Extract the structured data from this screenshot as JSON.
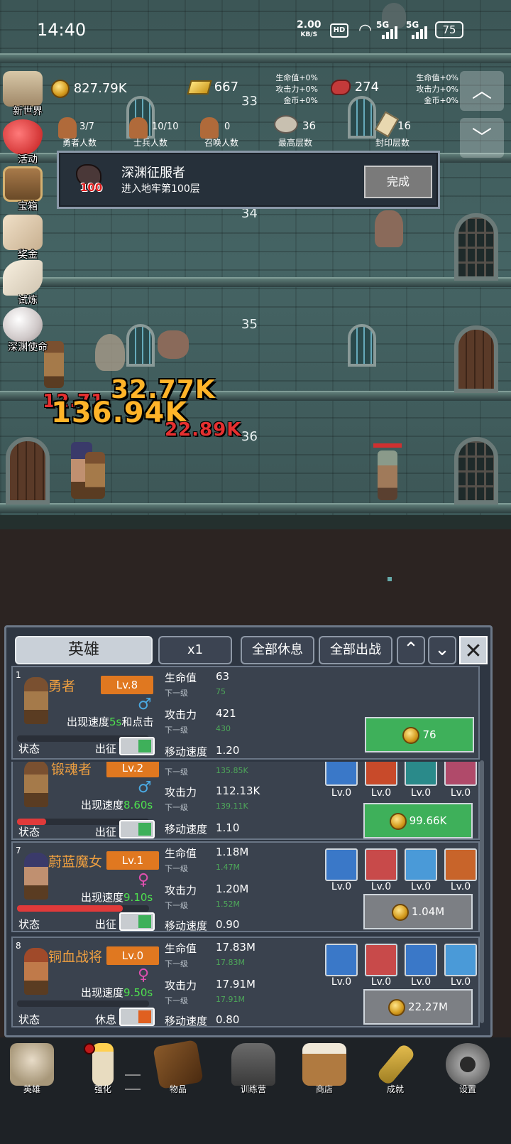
{
  "status_bar": {
    "time": "14:40",
    "net_speed": "2.00",
    "net_unit": "KB/S",
    "hd": "HD",
    "sig1": "5G",
    "sig2": "5G",
    "battery": "75"
  },
  "resources": {
    "coins": "827.79K",
    "gold_bars": "667",
    "meat": "274"
  },
  "buffs_left": [
    "生命值+0%",
    "攻击力+0%",
    "金币+0%"
  ],
  "buffs_right": [
    "生命值+0%",
    "攻击力+0%",
    "金币+0%"
  ],
  "counts": [
    {
      "value": "3/7",
      "label": "勇者人数"
    },
    {
      "value": "10/10",
      "label": "士兵人数"
    },
    {
      "value": "0",
      "label": "召唤人数"
    },
    {
      "value": "36",
      "label": "最高层数"
    },
    {
      "value": "16",
      "label": "封印层数"
    }
  ],
  "floors": [
    "33",
    "34",
    "35",
    "36"
  ],
  "side_menu": [
    "新世界",
    "活动",
    "宝箱",
    "奖金",
    "试炼",
    "深渊使命"
  ],
  "achievement": {
    "badge_num": "100",
    "title": "深渊征服者",
    "desc": "进入地牢第100层",
    "button": "完成"
  },
  "damage": {
    "big": "136.94K",
    "mid": "32.77K",
    "small": "22.89K",
    "bg": "12.71"
  },
  "panel": {
    "tabs": {
      "heroes": "英雄",
      "multiplier": "x1",
      "rest_all": "全部休息",
      "deploy_all": "全部出战"
    },
    "state_label": "状态",
    "stat_labels": {
      "hp": "生命值",
      "atk": "攻击力",
      "next": "下一级",
      "move": "移动速度"
    },
    "skill_lv": "Lv.0",
    "cards": [
      {
        "idx": "1",
        "name": "勇者",
        "lv": "Lv.8",
        "gender": "♂",
        "speed_pre": "出现速度",
        "speed_val": "5s",
        "speed_post": "和点击",
        "mode": "出征",
        "hp": "63",
        "hp_next": "75",
        "atk": "421",
        "atk_next": "430",
        "move": "1.20",
        "cost": "76",
        "cost_color": "green"
      },
      {
        "idx": "",
        "name": "锻魂者",
        "lv": "Lv.2",
        "gender": "♂",
        "speed_pre": "出现速度",
        "speed_val": "8.60s",
        "speed_post": "",
        "mode": "出征",
        "hp": "",
        "hp_next": "135.85K",
        "atk": "112.13K",
        "atk_next": "139.11K",
        "move": "1.10",
        "cost": "99.66K",
        "cost_color": "green",
        "hp_bar": 0.22
      },
      {
        "idx": "7",
        "name": "蔚蓝魔女",
        "lv": "Lv.1",
        "gender": "♀",
        "speed_pre": "出现速度",
        "speed_val": "9.10s",
        "speed_post": "",
        "mode": "出征",
        "hp": "1.18M",
        "hp_next": "1.47M",
        "atk": "1.20M",
        "atk_next": "1.52M",
        "move": "0.90",
        "cost": "1.04M",
        "cost_color": "gray",
        "hp_bar": 0.8
      },
      {
        "idx": "8",
        "name": "铜血战将",
        "lv": "Lv.0",
        "gender": "♀",
        "speed_pre": "出现速度",
        "speed_val": "9.50s",
        "speed_post": "",
        "mode": "休息",
        "hp": "17.83M",
        "hp_next": "17.83M",
        "atk": "17.91M",
        "atk_next": "17.91M",
        "move": "0.80",
        "cost": "22.27M",
        "cost_color": "gray",
        "hp_bar": 0
      }
    ]
  },
  "nav": [
    "英雄",
    "强化",
    "物品",
    "训练营",
    "商店",
    "成就",
    "设置"
  ],
  "colors": {
    "accent_orange": "#e07820",
    "green": "#3eb05a",
    "gray_button": "#7c7f84",
    "panel_bg": "#2e3642",
    "dungeon": "#456464"
  }
}
